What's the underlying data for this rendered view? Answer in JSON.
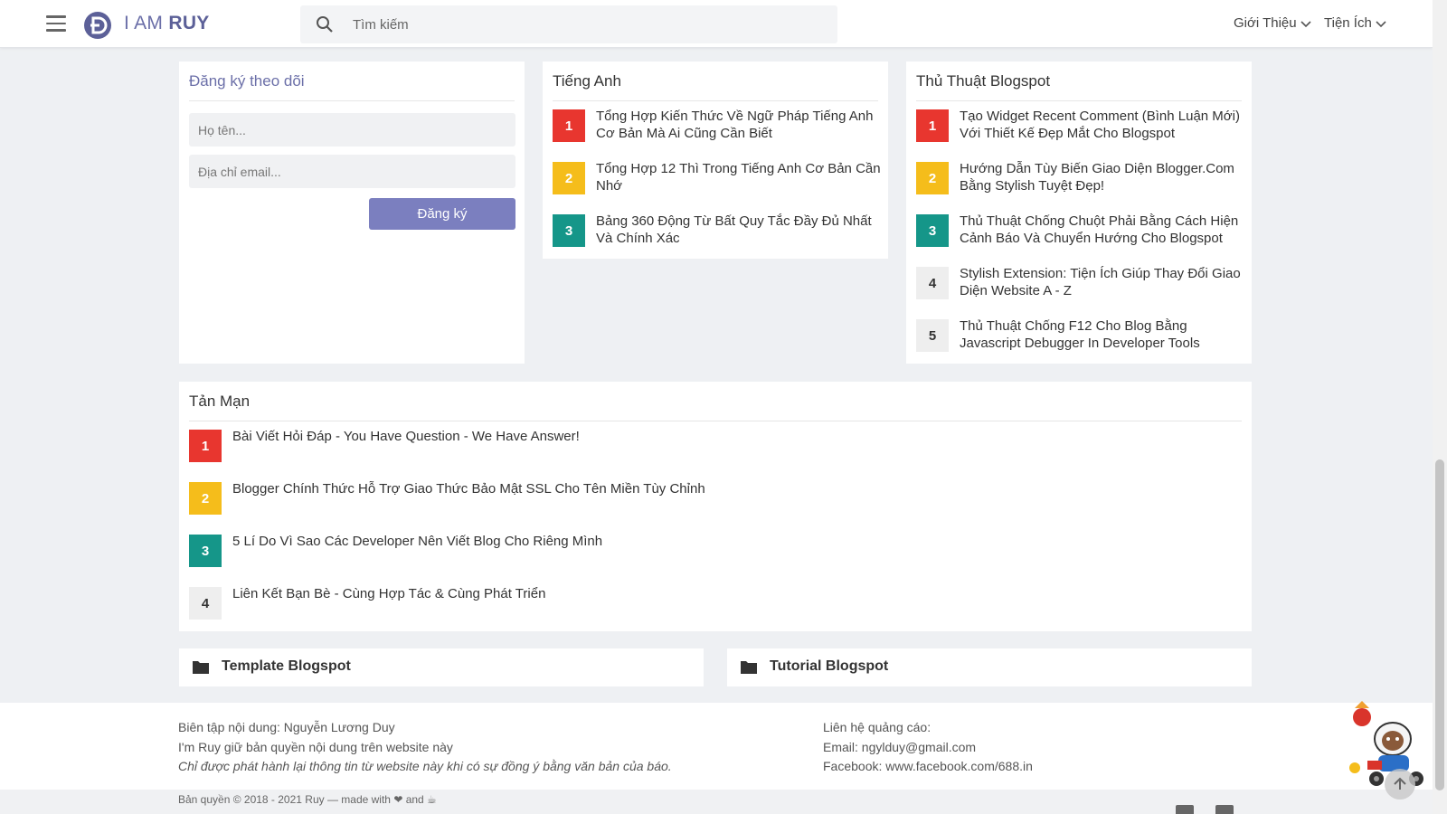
{
  "header": {
    "logo_prefix": "I AM ",
    "logo_bold": "RUY",
    "search_placeholder": "Tìm kiếm",
    "nav": [
      "Giới Thiệu",
      "Tiện Ích"
    ]
  },
  "subscribe": {
    "title": "Đăng ký theo dõi",
    "name_placeholder": "Họ tên...",
    "email_placeholder": "Địa chỉ email...",
    "button": "Đăng ký"
  },
  "tieng_anh": {
    "title": "Tiếng Anh",
    "posts": [
      {
        "num": "1",
        "title": "Tổng Hợp Kiến Thức Về Ngữ Pháp Tiếng Anh Cơ Bản Mà Ai Cũng Cần Biết"
      },
      {
        "num": "2",
        "title": "Tổng Hợp 12 Thì Trong Tiếng Anh Cơ Bản Cần Nhớ"
      },
      {
        "num": "3",
        "title": "Bảng 360 Động Từ Bất Quy Tắc Đầy Đủ Nhất Và Chính Xác"
      }
    ]
  },
  "thu_thuat": {
    "title": "Thủ Thuật Blogspot",
    "posts": [
      {
        "num": "1",
        "title": "Tạo Widget Recent Comment (Bình Luận Mới) Với Thiết Kế Đẹp Mắt Cho Blogspot"
      },
      {
        "num": "2",
        "title": "Hướng Dẫn Tùy Biến Giao Diện Blogger.Com Bằng Stylish Tuyệt Đẹp!"
      },
      {
        "num": "3",
        "title": "Thủ Thuật Chống Chuột Phải Bằng Cách Hiện Cảnh Báo Và Chuyển Hướng Cho Blogspot"
      },
      {
        "num": "4",
        "title": "Stylish Extension: Tiện Ích Giúp Thay Đổi Giao Diện Website A - Z"
      },
      {
        "num": "5",
        "title": "Thủ Thuật Chống F12 Cho Blog Bằng Javascript Debugger In Developer Tools"
      }
    ]
  },
  "tan_man": {
    "title": "Tản Mạn",
    "posts": [
      {
        "num": "1",
        "title": "Bài Viết Hỏi Đáp - You Have Question - We Have Answer!"
      },
      {
        "num": "2",
        "title": "Blogger Chính Thức Hỗ Trợ Giao Thức Bảo Mật SSL Cho Tên Miền Tùy Chỉnh"
      },
      {
        "num": "3",
        "title": "5 Lí Do Vì Sao Các Developer Nên Viết Blog Cho Riêng Mình"
      },
      {
        "num": "4",
        "title": "Liên Kết Bạn Bè - Cùng Hợp Tác & Cùng Phát Triển"
      }
    ]
  },
  "categories": [
    "Template Blogspot",
    "Tutorial Blogspot"
  ],
  "footer": {
    "editor": "Biên tập nội dung: Nguyễn Lương Duy",
    "copyright_note": "I'm Ruy giữ bản quyền nội dung trên website này",
    "republish_note": "Chỉ được phát hành lại thông tin từ website này khi có sự đồng ý bằng văn bản của báo.",
    "ads": "Liên hệ quảng cáo:",
    "email": "Email: ngylduy@gmail.com",
    "facebook": "Facebook: www.facebook.com/688.in",
    "copyright": "Bản quyền © 2018 - 2021 Ruy — made with ❤ and ☕"
  },
  "colors": {
    "accent": "#7b7fbf",
    "red": "#e8362f",
    "yellow": "#f5bd1b",
    "green": "#159689"
  }
}
